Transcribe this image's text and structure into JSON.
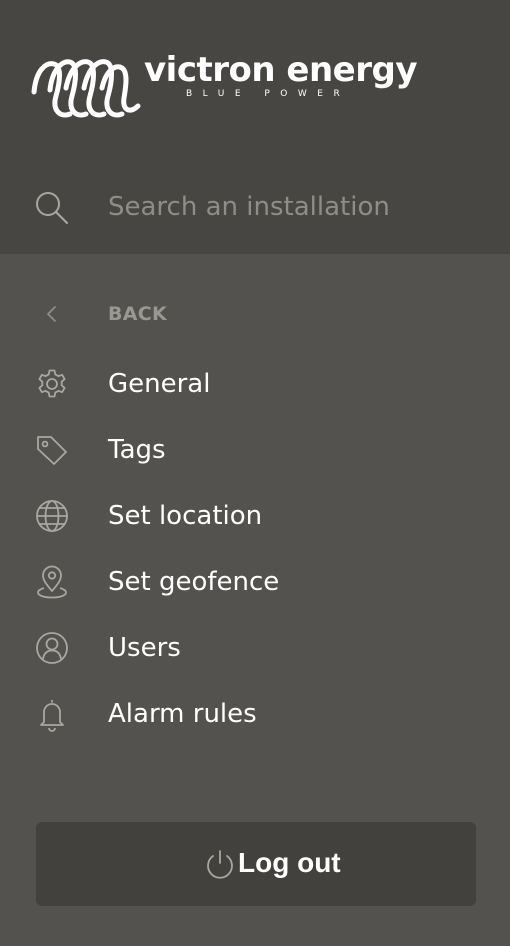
{
  "brand": {
    "name": "victron energy",
    "tagline": "BLUE POWER"
  },
  "search": {
    "placeholder": "Search an installation",
    "value": "",
    "icon": "search-icon"
  },
  "nav": {
    "back_label": "BACK",
    "back_icon": "chevron-left-icon",
    "items": [
      {
        "label": "General",
        "icon": "gear-icon"
      },
      {
        "label": "Tags",
        "icon": "tag-icon"
      },
      {
        "label": "Set location",
        "icon": "globe-icon"
      },
      {
        "label": "Set geofence",
        "icon": "map-pin-icon"
      },
      {
        "label": "Users",
        "icon": "user-circle-icon"
      },
      {
        "label": "Alarm rules",
        "icon": "bell-icon"
      }
    ]
  },
  "logout": {
    "label": "Log out",
    "icon": "power-icon"
  },
  "colors": {
    "header_background": "#474642",
    "panel_background": "#53524e",
    "logout_background": "#42413d",
    "text_primary": "#ffffff",
    "text_muted": "#8f8d87",
    "icon_stroke": "#a9a7a1"
  }
}
